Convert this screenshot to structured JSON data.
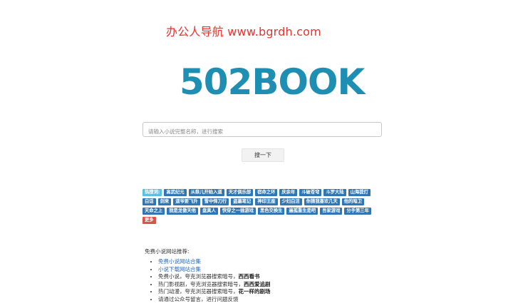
{
  "watermark": "办公人导航  www.bgrdh.com",
  "logo": "502BOOK",
  "search": {
    "placeholder": "请输入小说完整名称，进行搜索",
    "button_label": "搜一下"
  },
  "hotwords": {
    "label": "热搜词:",
    "tags": [
      "高武纪元",
      "从祭儿开始入道",
      "天才俱乐部",
      "宿命之环",
      "庆余年",
      "斗破苍穹",
      "斗罗大陆",
      "山海提灯",
      "白话",
      "剑来",
      "道爷要飞升",
      "雪中悍刀行",
      "盗墓笔记",
      "神印王座",
      "少妇白洁",
      "你猜我喜欢几天",
      "他的暗卫",
      "天命之上",
      "我是龙傲天他",
      "盘真人",
      "快穿之一插游戏",
      "黑色交换生",
      "遍孤重生是吧",
      "吾家游戏",
      "分手第三年"
    ],
    "more_label": "更多"
  },
  "recommend": {
    "heading": "免费小说网站推荐:",
    "links": [
      "免费小说网站合集",
      "小说下载网站合集"
    ],
    "items": [
      {
        "text": "免费小说，夸克浏览器搜索暗号，",
        "bold": "西西看书"
      },
      {
        "text": "热门影视剧，夸克浏览器搜索暗号，",
        "bold": "西西爱追剧"
      },
      {
        "text": "热门动漫，夸克浏览器搜索暗号，",
        "bold": "花一样的剧场"
      },
      {
        "text": "请通过公众号留言，进行问题反馈",
        "bold": ""
      }
    ]
  }
}
